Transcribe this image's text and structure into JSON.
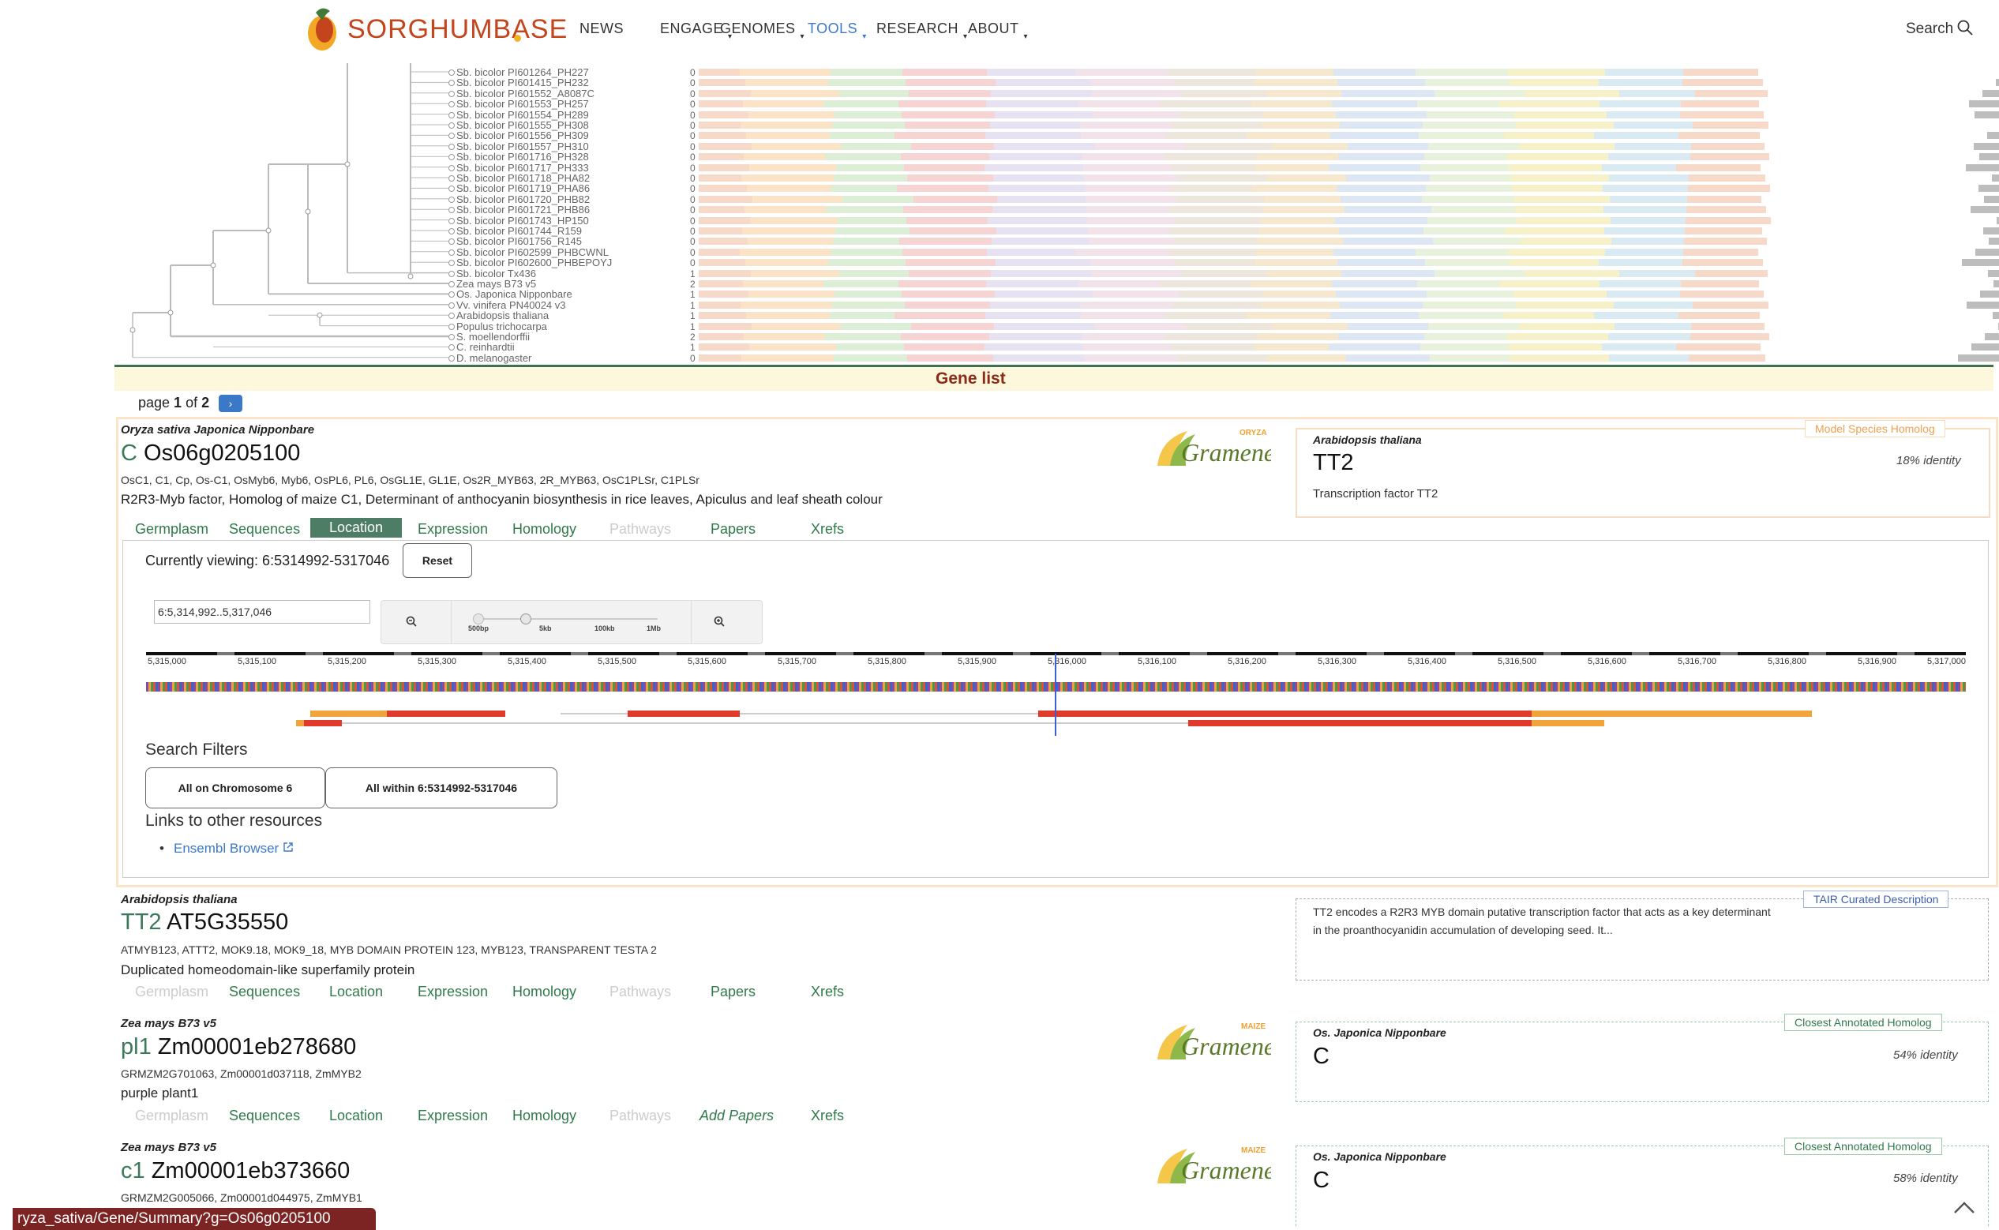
{
  "header": {
    "logo": "SORGHUMBASE",
    "nav": [
      {
        "label": "NEWS",
        "active": false
      },
      {
        "label": "ENGAGE",
        "active": false
      },
      {
        "label": "GENOMES",
        "active": false
      },
      {
        "label": "TOOLS",
        "active": true
      },
      {
        "label": "RESEARCH",
        "active": false
      },
      {
        "label": "ABOUT",
        "active": false
      }
    ],
    "search_label": "Search"
  },
  "tree": {
    "taxa": [
      "Sb. bicolor PI601264_PH227",
      "Sb. bicolor PI601415_PH232",
      "Sb. bicolor PI601552_A8087C",
      "Sb. bicolor PI601553_PH257",
      "Sb. bicolor PI601554_PH289",
      "Sb. bicolor PI601555_PH308",
      "Sb. bicolor PI601556_PH309",
      "Sb. bicolor PI601557_PH310",
      "Sb. bicolor PI601716_PH328",
      "Sb. bicolor PI601717_PH333",
      "Sb. bicolor PI601718_PHA82",
      "Sb. bicolor PI601719_PHA86",
      "Sb. bicolor PI601720_PHB82",
      "Sb. bicolor PI601721_PHB86",
      "Sb. bicolor PI601743_HP150",
      "Sb. bicolor PI601744_R159",
      "Sb. bicolor PI601756_R145",
      "Sb. bicolor PI602599_PHBCWNL",
      "Sb. bicolor PI602600_PHBEPOYJ",
      "Sb. bicolor Tx436",
      "Zea mays B73 v5",
      "Os. Japonica Nipponbare",
      "Vv. vinifera PN40024 v3",
      "Arabidopsis thaliana",
      "Populus trichocarpa",
      "S. moellendorffii",
      "C. reinhardtii",
      "D. melanogaster"
    ],
    "counts": [
      "0",
      "0",
      "0",
      "0",
      "0",
      "0",
      "0",
      "0",
      "0",
      "0",
      "0",
      "0",
      "0",
      "0",
      "0",
      "0",
      "0",
      "0",
      "0",
      "1",
      "2",
      "1",
      "1",
      "1",
      "1",
      "2",
      "1",
      "0"
    ]
  },
  "gene_list": {
    "title": "Gene list",
    "pager_prefix": "page ",
    "pager_current": "1",
    "pager_mid": " of ",
    "pager_total": "2",
    "pager_next": "›"
  },
  "genes": [
    {
      "species": "Oryza sativa Japonica Nipponbare",
      "symbol": "C",
      "id": "Os06g0205100",
      "synonyms": "OsC1, C1, Cp, Os-C1, OsMyb6, Myb6, OsPL6, PL6, OsGL1E, GL1E, Os2R_MYB63, 2R_MYB63, OsC1PLSr, C1PLSr",
      "description": "R2R3-Myb factor, Homolog of maize C1, Determinant of anthocyanin biosynthesis in rice leaves, Apiculus and leaf sheath colour",
      "gramene_tag": "ORYZA",
      "tabs": [
        "Germplasm",
        "Sequences",
        "Location",
        "Expression",
        "Homology",
        "Pathways",
        "Papers",
        "Xrefs"
      ],
      "homolog": {
        "badge": "Model Species Homolog",
        "species": "Arabidopsis thaliana",
        "name": "TT2",
        "identity": "18% identity",
        "desc": "Transcription factor TT2"
      }
    },
    {
      "species": "Arabidopsis thaliana",
      "symbol": "TT2",
      "id": "AT5G35550",
      "synonyms": "ATMYB123, ATTT2, MOK9.18, MOK9_18, MYB DOMAIN PROTEIN 123, MYB123, TRANSPARENT TESTA 2",
      "description": "Duplicated homeodomain-like superfamily protein",
      "tabs": [
        "Germplasm",
        "Sequences",
        "Location",
        "Expression",
        "Homology",
        "Pathways",
        "Papers",
        "Xrefs"
      ],
      "homolog": {
        "badge": "TAIR Curated Description",
        "text": "TT2 encodes a R2R3 MYB domain putative transcription factor that acts as a key determinant in the proanthocyanidin accumulation of developing seed. It..."
      }
    },
    {
      "species": "Zea mays B73 v5",
      "symbol": "pl1",
      "id": "Zm00001eb278680",
      "synonyms": "GRMZM2G701063, Zm00001d037118, ZmMYB2",
      "description": "purple plant1",
      "gramene_tag": "MAIZE",
      "tabs": [
        "Germplasm",
        "Sequences",
        "Location",
        "Expression",
        "Homology",
        "Pathways",
        "Add Papers",
        "Xrefs"
      ],
      "homolog": {
        "badge": "Closest Annotated Homolog",
        "species": "Os. Japonica Nipponbare",
        "name": "C",
        "identity": "54% identity"
      }
    },
    {
      "species": "Zea mays B73 v5",
      "symbol": "c1",
      "id": "Zm00001eb373660",
      "synonyms": "GRMZM2G005066, Zm00001d044975, ZmMYB1",
      "gramene_tag": "MAIZE",
      "homolog": {
        "badge": "Closest Annotated Homolog",
        "species": "Os. Japonica Nipponbare",
        "name": "C",
        "identity": "58% identity"
      }
    }
  ],
  "gramene_word": "Gramene",
  "location": {
    "currently_viewing": "Currently viewing: 6:5314992-5317046",
    "reset": "Reset",
    "input_value": "6:5,314,992..5,317,046",
    "zoom_labels": [
      "500bp",
      "5kb",
      "100kb",
      "1Mb"
    ],
    "ruler_labels": [
      "5,315,000",
      "5,315,100",
      "5,315,200",
      "5,315,300",
      "5,315,400",
      "5,315,500",
      "5,315,600",
      "5,315,700",
      "5,315,800",
      "5,315,900",
      "5,316,000",
      "5,316,100",
      "5,316,200",
      "5,316,300",
      "5,316,400",
      "5,316,500",
      "5,316,600",
      "5,316,700",
      "5,316,800",
      "5,316,900",
      "5,317,000"
    ],
    "search_filters_title": "Search Filters",
    "filter_chromosome": "All on Chromosome 6",
    "filter_within": "All within 6:5314992-5317046",
    "links_title": "Links to other resources",
    "ensembl": "Ensembl Browser",
    "bullet": "•"
  },
  "status_url": "ryza_sativa/Gene/Summary?g=Os06g0205100",
  "colors": {
    "accent": "#3b78c7",
    "logo": "#c4451c",
    "gene_list_title": "#8b2a18",
    "tab_green": "#2f7a4a",
    "tab_selected_bg": "#4d7d64",
    "exon_red": "#e03a2c",
    "utr_orange": "#f0a43a"
  }
}
